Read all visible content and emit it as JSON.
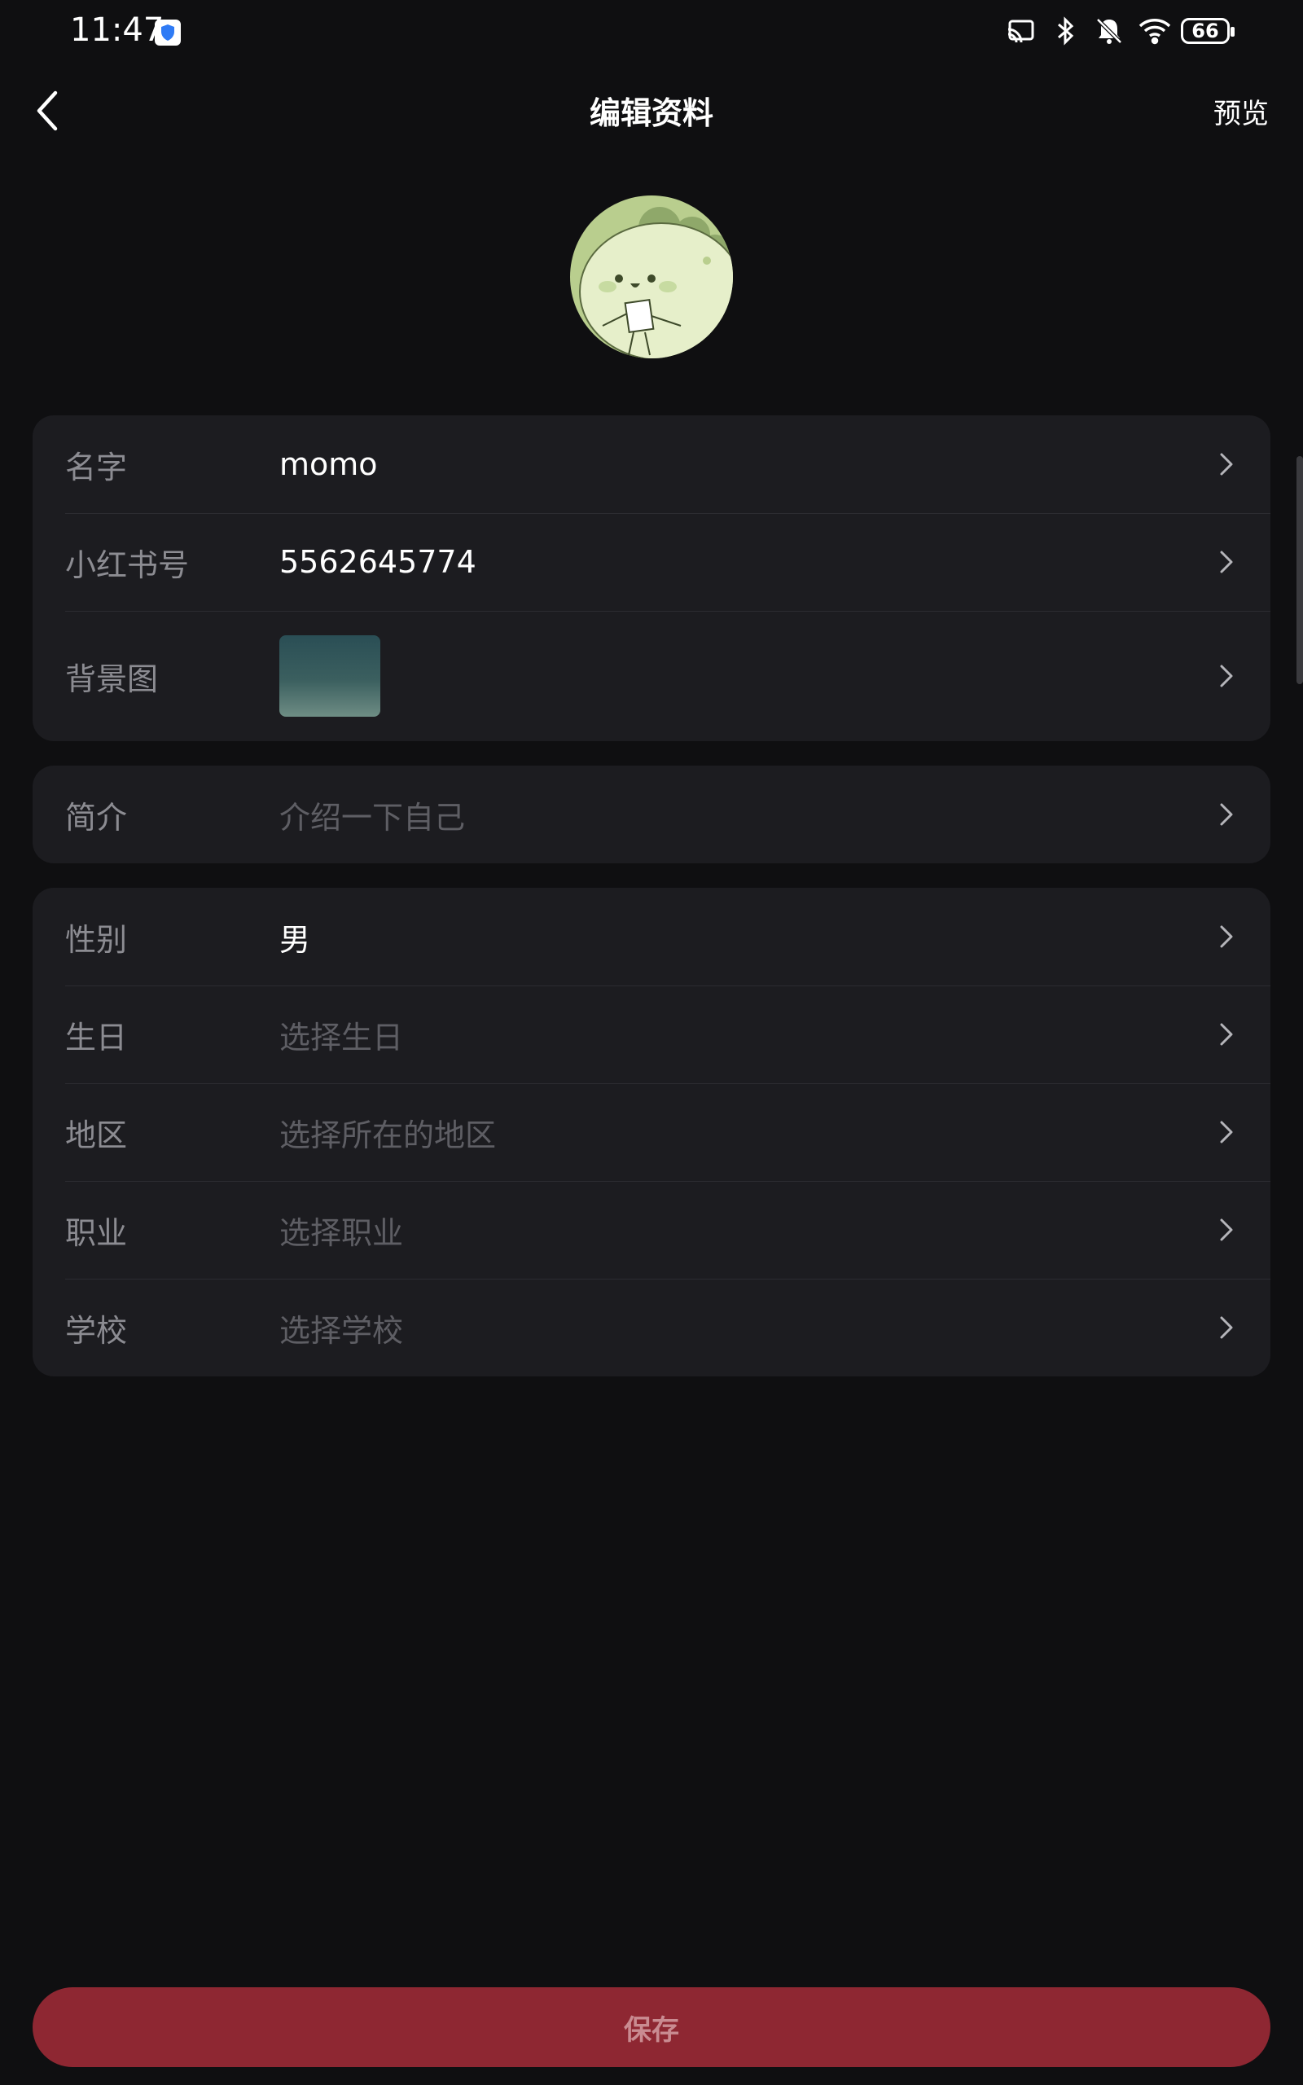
{
  "status_bar": {
    "time": "11:47",
    "battery": "66",
    "icons": [
      "cast-icon",
      "bluetooth-icon",
      "bell-off-icon",
      "wifi-icon",
      "battery-icon"
    ]
  },
  "header": {
    "title": "编辑资料",
    "preview_label": "预览"
  },
  "profile_card": {
    "name_label": "名字",
    "name_value": "momo",
    "id_label": "小红书号",
    "id_value": "5562645774",
    "background_label": "背景图"
  },
  "bio_card": {
    "bio_label": "简介",
    "bio_placeholder": "介绍一下自己"
  },
  "details_card": {
    "gender_label": "性别",
    "gender_value": "男",
    "birthday_label": "生日",
    "birthday_placeholder": "选择生日",
    "region_label": "地区",
    "region_placeholder": "选择所在的地区",
    "job_label": "职业",
    "job_placeholder": "选择职业",
    "school_label": "学校",
    "school_placeholder": "选择学校"
  },
  "footer": {
    "save_label": "保存"
  },
  "colors": {
    "background": "#0f0f11",
    "card": "#1c1c20",
    "save_button": "#8e2732"
  }
}
